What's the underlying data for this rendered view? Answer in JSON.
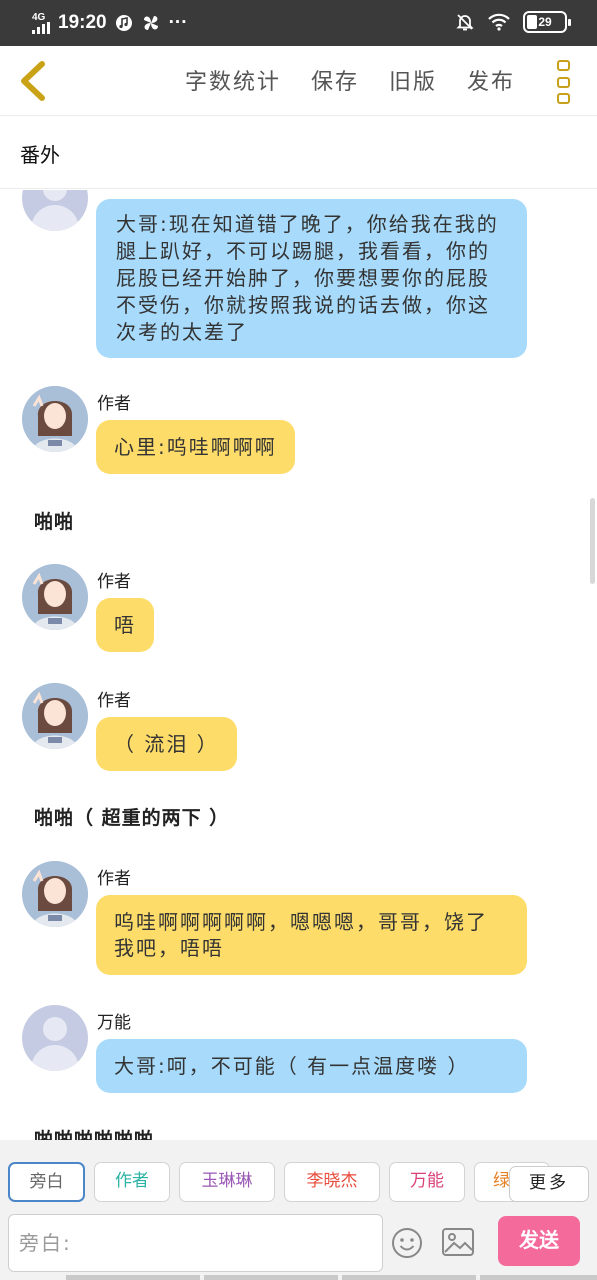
{
  "status_bar": {
    "network": "4G",
    "time": "19:20",
    "dots": "···",
    "battery": "29",
    "battery_level": 0.29
  },
  "toolbar": {
    "actions": [
      "字数统计",
      "保存",
      "旧版",
      "发布"
    ]
  },
  "section_title": "番外",
  "messages": [
    {
      "type": "bubble",
      "speaker": "",
      "avatar": "blank",
      "color": "blue",
      "text": "大哥:现在知道错了晚了，你给我在我的腿上趴好，不可以踢腿，我看看，你的屁股已经开始肿了，你要想要你的屁股不受伤，你就按照我说的话去做，你这次考的太差了"
    },
    {
      "type": "bubble",
      "speaker": "作者",
      "avatar": "girl",
      "color": "yellow",
      "text": "心里:呜哇啊啊啊"
    },
    {
      "type": "narration",
      "text": "啪啪"
    },
    {
      "type": "bubble",
      "speaker": "作者",
      "avatar": "girl",
      "color": "yellow",
      "text": "唔"
    },
    {
      "type": "bubble",
      "speaker": "作者",
      "avatar": "girl",
      "color": "yellow",
      "text": "（ 流泪 ）"
    },
    {
      "type": "narration",
      "text": "啪啪（ 超重的两下 ）"
    },
    {
      "type": "bubble",
      "speaker": "作者",
      "avatar": "girl",
      "color": "yellow",
      "text": "呜哇啊啊啊啊啊，嗯嗯嗯，哥哥，饶了我吧，唔唔"
    },
    {
      "type": "bubble",
      "speaker": "万能",
      "avatar": "blank",
      "color": "blue",
      "text": "大哥:呵，不可能（ 有一点温度喽 ）"
    },
    {
      "type": "narration",
      "text": "啪啪啪啪啪啪"
    }
  ],
  "roles": [
    {
      "label": "旁白",
      "color": "#666666"
    },
    {
      "label": "作者",
      "color": "#2bb3a3"
    },
    {
      "label": "玉琳琳",
      "color": "#9b59b6"
    },
    {
      "label": "李晓杰",
      "color": "#e74c3c"
    },
    {
      "label": "万能",
      "color": "#d9427a"
    },
    {
      "label": "绿",
      "color": "#e67e22"
    }
  ],
  "more_roles_label": "更多",
  "composer": {
    "placeholder": "旁白:",
    "send_label": "发送"
  }
}
